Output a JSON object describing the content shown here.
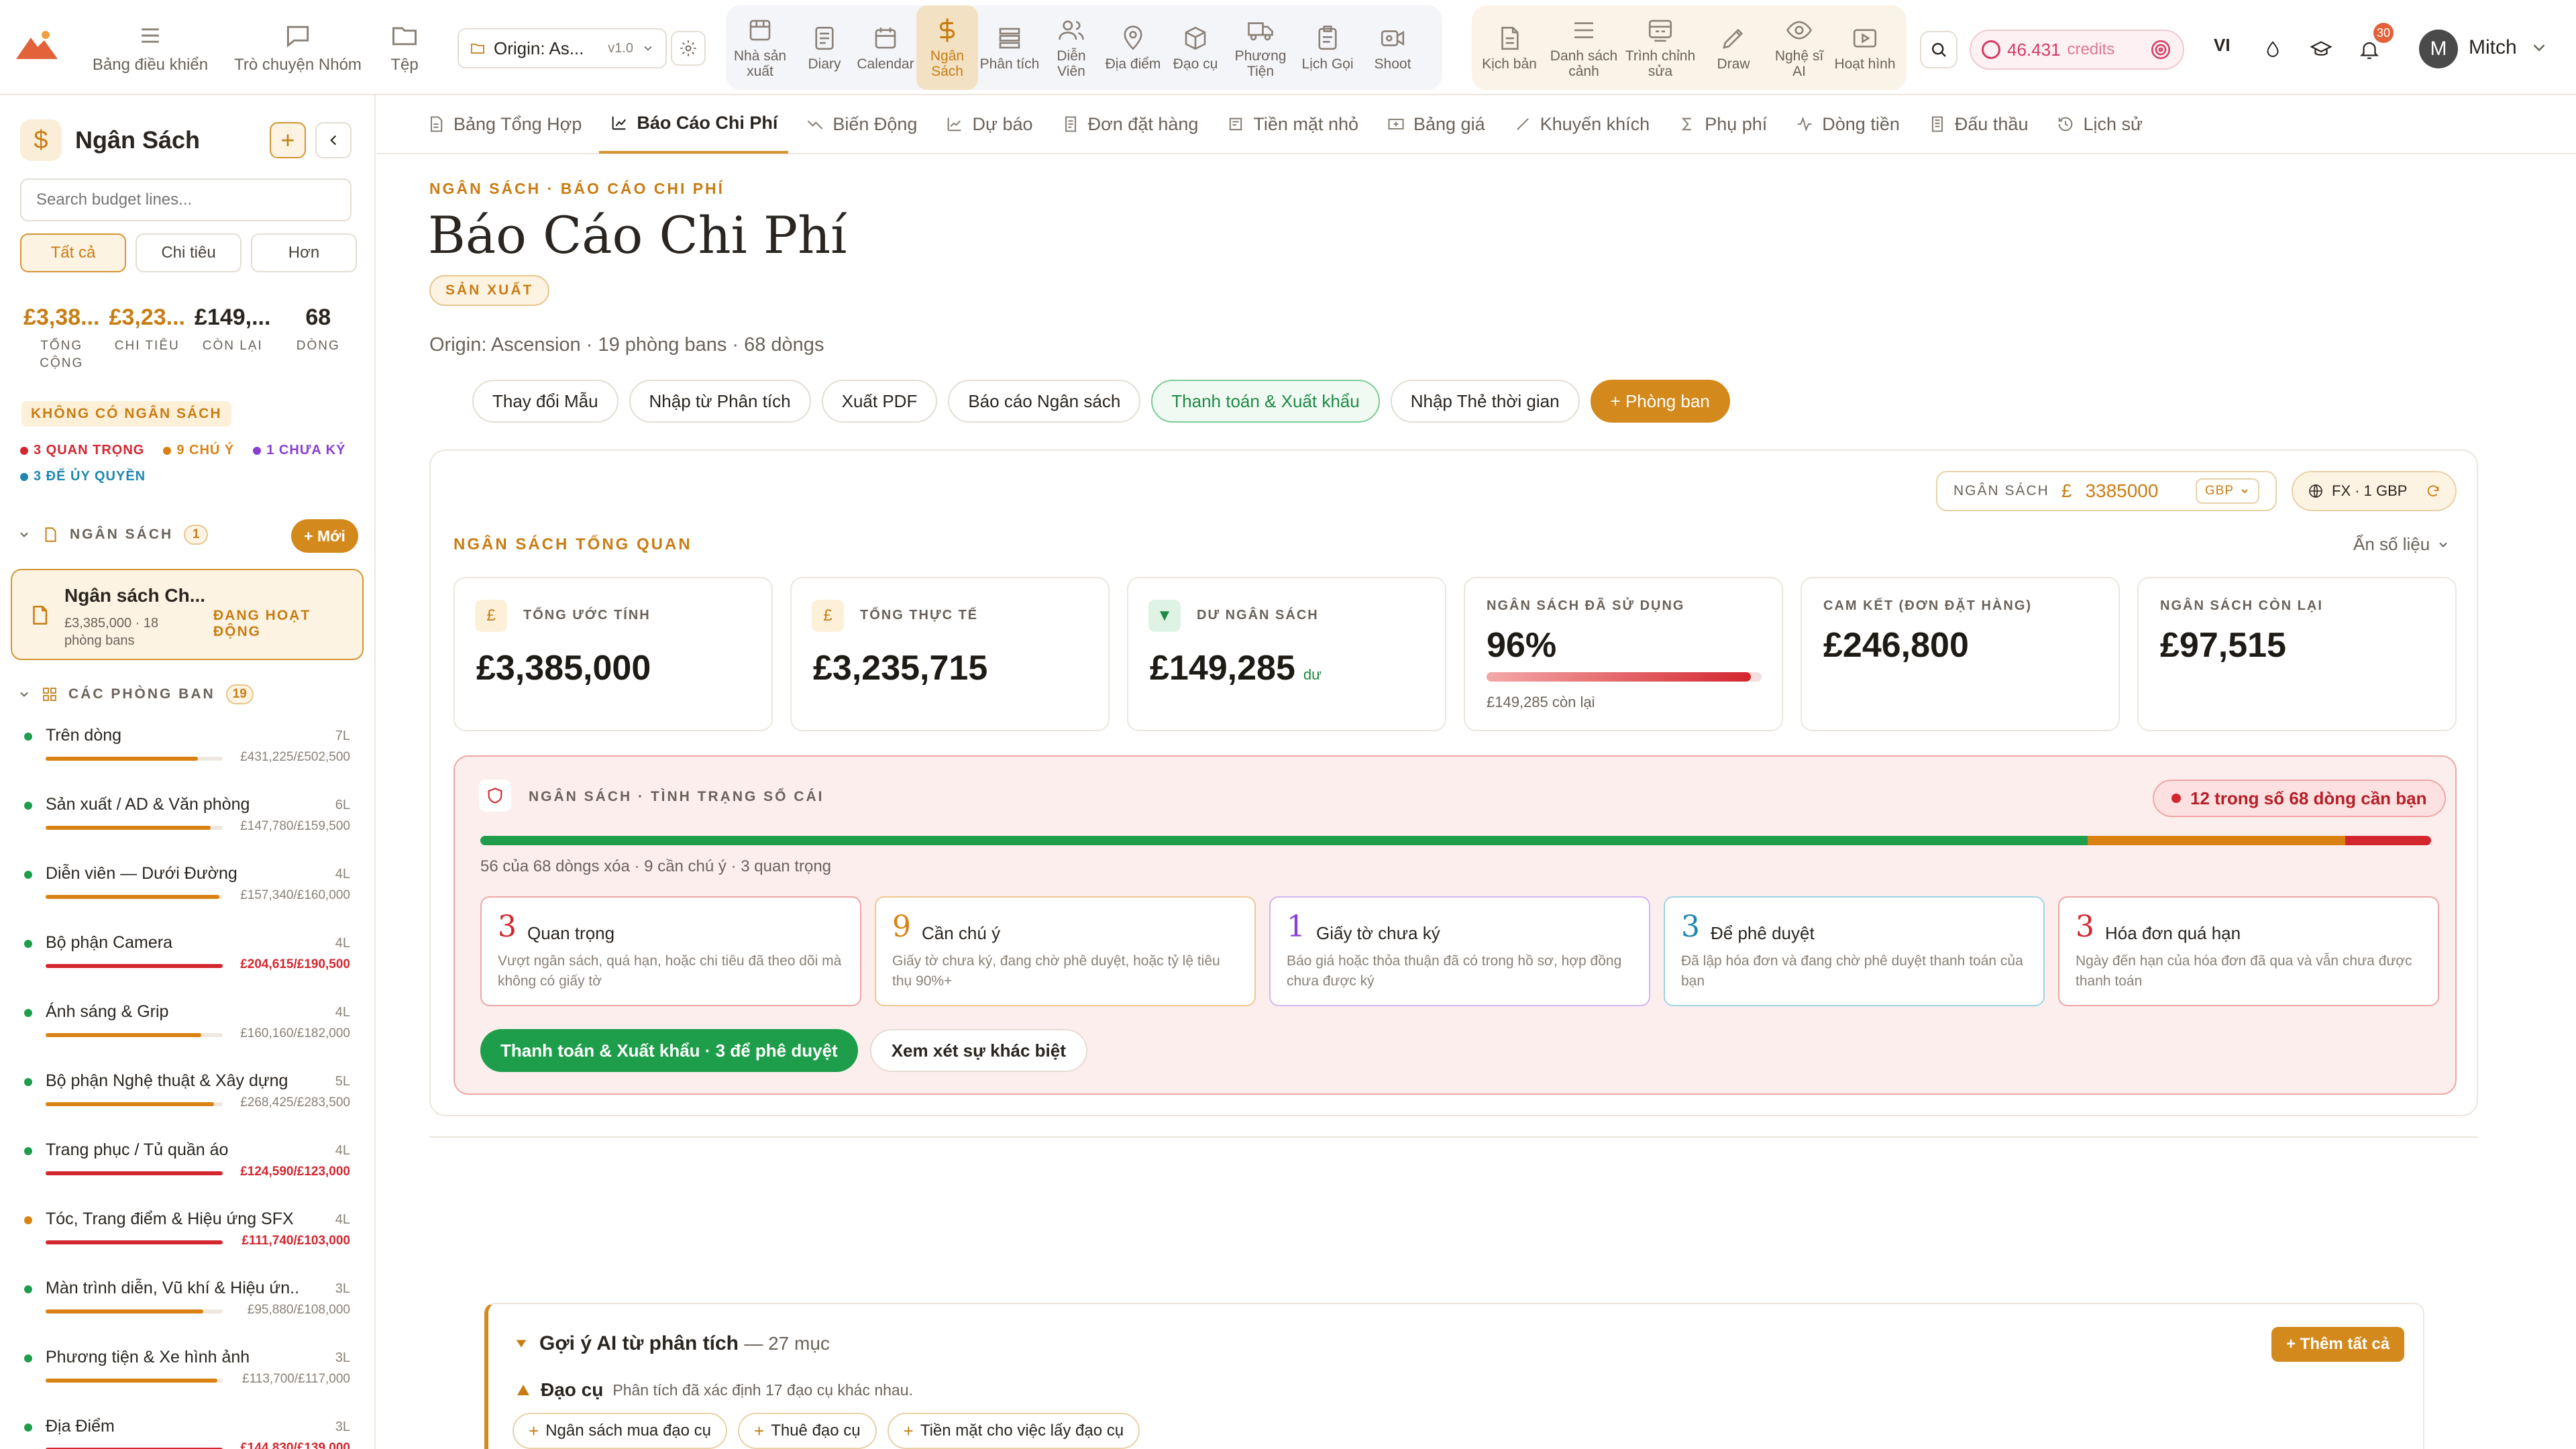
{
  "topnav": {
    "left": [
      {
        "label": "Bảng điều khiển",
        "icon": "menu-icon"
      },
      {
        "label": "Trò chuyện Nhóm",
        "icon": "chat-icon"
      },
      {
        "label": "Tệp",
        "icon": "folder-icon"
      }
    ],
    "origin": {
      "label": "Origin: As...",
      "version": "v1.0"
    },
    "group1": [
      {
        "label": "Nhà sản xuất",
        "icon": "producer-icon"
      },
      {
        "label": "Diary",
        "icon": "diary-icon"
      },
      {
        "label": "Calendar",
        "icon": "calendar-icon"
      },
      {
        "label": "Ngân Sách",
        "icon": "dollar-icon",
        "active": true
      },
      {
        "label": "Phân tích",
        "icon": "analysis-icon"
      },
      {
        "label": "Diễn Viên",
        "icon": "cast-icon"
      },
      {
        "label": "Địa điểm",
        "icon": "location-icon"
      },
      {
        "label": "Đạo cụ",
        "icon": "props-icon"
      },
      {
        "label": "Phương Tiện",
        "icon": "vehicle-icon"
      },
      {
        "label": "Lịch Gọi",
        "icon": "callsheet-icon"
      },
      {
        "label": "Shoot",
        "icon": "camera-icon"
      }
    ],
    "group2": [
      {
        "label": "Kịch bản",
        "icon": "script-icon"
      },
      {
        "label": "Danh sách cảnh",
        "icon": "list-icon"
      },
      {
        "label": "Trình chỉnh sửa",
        "icon": "editor-icon"
      },
      {
        "label": "Draw",
        "icon": "pen-icon"
      },
      {
        "label": "Nghệ sĩ AI",
        "icon": "eye-icon"
      },
      {
        "label": "Hoạt hình",
        "icon": "play-icon"
      }
    ],
    "credits": {
      "amount": "46.431",
      "label": "credits"
    },
    "lang": "VI",
    "notifications": "30",
    "user": {
      "initial": "M",
      "name": "Mitch"
    }
  },
  "sidebar": {
    "title": "Ngân Sách",
    "search_placeholder": "Search budget lines...",
    "filters": [
      "Tất cả",
      "Chi tiêu",
      "Hơn"
    ],
    "stats": [
      {
        "value": "£3,38...",
        "label": "TỔNG CỘNG"
      },
      {
        "value": "£3,23...",
        "label": "CHI TIÊU"
      },
      {
        "value": "£149,...",
        "label": "CÒN LẠI"
      },
      {
        "value": "68",
        "label": "DÒNG"
      }
    ],
    "no_budget": "KHÔNG CÓ NGÂN SÁCH",
    "badges": [
      {
        "text": "3 QUAN TRỌNG",
        "color": "#d3262f"
      },
      {
        "text": "9 CHÚ Ý",
        "color": "#d98213"
      },
      {
        "text": "1 CHƯA KÝ",
        "color": "#8a3fd1"
      },
      {
        "text": "3 ĐỂ ỦY QUYỀN",
        "color": "#1e86b0"
      }
    ],
    "budgets_section": {
      "label": "NGÂN SÁCH",
      "count": "1",
      "new_label": "+ Mới"
    },
    "active_budget": {
      "title": "Ngân sách Ch...",
      "subtitle": "£3,385,000 · 18 phòng bans",
      "status": "ĐANG HOẠT ĐỘNG"
    },
    "depts_section": {
      "label": "CÁC PHÒNG BAN",
      "count": "19"
    },
    "departments": [
      {
        "name": "Trên dòng",
        "lines": "7L",
        "spent": "£431,225",
        "budget": "£502,500",
        "ratio": 0.86,
        "over": false,
        "dot": "#1e9e4a"
      },
      {
        "name": "Sản xuất / AD & Văn phòng",
        "lines": "6L",
        "spent": "£147,780",
        "budget": "£159,500",
        "ratio": 0.93,
        "over": false,
        "dot": "#1e9e4a"
      },
      {
        "name": "Diễn viên — Dưới Đường",
        "lines": "4L",
        "spent": "£157,340",
        "budget": "£160,000",
        "ratio": 0.98,
        "over": false,
        "dot": "#1e9e4a"
      },
      {
        "name": "Bộ phận Camera",
        "lines": "4L",
        "spent": "£204,615",
        "budget": "£190,500",
        "ratio": 1,
        "over": true,
        "dot": "#1e9e4a"
      },
      {
        "name": "Ánh sáng & Grip",
        "lines": "4L",
        "spent": "£160,160",
        "budget": "£182,000",
        "ratio": 0.88,
        "over": false,
        "dot": "#1e9e4a"
      },
      {
        "name": "Bộ phận Nghệ thuật & Xây dựng",
        "lines": "5L",
        "spent": "£268,425",
        "budget": "£283,500",
        "ratio": 0.95,
        "over": false,
        "dot": "#1e9e4a"
      },
      {
        "name": "Trang phục / Tủ quần áo",
        "lines": "4L",
        "spent": "£124,590",
        "budget": "£123,000",
        "ratio": 1,
        "over": true,
        "dot": "#1e9e4a"
      },
      {
        "name": "Tóc, Trang điểm & Hiệu ứng SFX",
        "lines": "4L",
        "spent": "£111,740",
        "budget": "£103,000",
        "ratio": 1,
        "over": true,
        "dot": "#d98213"
      },
      {
        "name": "Màn trình diễn, Vũ khí & Hiệu ứn...",
        "lines": "3L",
        "spent": "£95,880",
        "budget": "£108,000",
        "ratio": 0.89,
        "over": false,
        "dot": "#1e9e4a"
      },
      {
        "name": "Phương tiện & Xe hình ảnh",
        "lines": "3L",
        "spent": "£113,700",
        "budget": "£117,000",
        "ratio": 0.97,
        "over": false,
        "dot": "#1e9e4a"
      },
      {
        "name": "Địa Điểm",
        "lines": "3L",
        "spent": "£144,830",
        "budget": "£139,000",
        "ratio": 1,
        "over": true,
        "dot": "#1e9e4a"
      }
    ]
  },
  "subtabs": [
    {
      "label": "Bảng Tổng Hợp",
      "icon": "doc-icon"
    },
    {
      "label": "Báo Cáo Chi Phí",
      "icon": "chart-icon",
      "active": true
    },
    {
      "label": "Biến Động",
      "icon": "trend-icon"
    },
    {
      "label": "Dự báo",
      "icon": "forecast-icon"
    },
    {
      "label": "Đơn đặt hàng",
      "icon": "order-icon"
    },
    {
      "label": "Tiền mặt nhỏ",
      "icon": "cash-icon"
    },
    {
      "label": "Bảng giá",
      "icon": "price-icon"
    },
    {
      "label": "Khuyến khích",
      "icon": "percent-icon"
    },
    {
      "label": "Phụ phí",
      "icon": "sigma-icon"
    },
    {
      "label": "Dòng tiền",
      "icon": "pulse-icon"
    },
    {
      "label": "Đấu thầu",
      "icon": "tender-icon"
    },
    {
      "label": "Lịch sử",
      "icon": "history-icon"
    }
  ],
  "main": {
    "breadcrumb": "NGÂN SÁCH · BÁO CÁO CHI PHÍ",
    "title": "Báo Cáo Chi Phí",
    "tag": "SẢN XUẤT",
    "subtitle": "Origin: Ascension · 19 phòng bans · 68 dòngs",
    "actions": [
      {
        "label": "Thay đổi Mẫu",
        "style": "plain"
      },
      {
        "label": "Nhập từ Phân tích",
        "style": "plain"
      },
      {
        "label": "Xuất PDF",
        "style": "plain"
      },
      {
        "label": "Báo cáo Ngân sách",
        "style": "plain"
      },
      {
        "label": "Thanh toán & Xuất khẩu",
        "style": "green"
      },
      {
        "label": "Nhập Thẻ thời gian",
        "style": "plain"
      },
      {
        "label": "+ Phòng ban",
        "style": "gold"
      }
    ],
    "budget_input": {
      "label": "NGÂN SÁCH",
      "symbol": "£",
      "value": "3385000",
      "currency": "GBP"
    },
    "fx": "FX · 1 GBP",
    "overview_label": "NGÂN SÁCH TỔNG QUAN",
    "hide_figures": "Ẩn số liệu",
    "metrics": [
      {
        "label": "TỔNG ƯỚC TÍNH",
        "value": "£3,385,000",
        "icon": "£"
      },
      {
        "label": "TỔNG THỰC TẾ",
        "value": "£3,235,715",
        "icon": "£"
      },
      {
        "label": "DƯ NGÂN SÁCH",
        "value": "£149,285",
        "unit": "dư",
        "icon": "▼"
      },
      {
        "label": "NGÂN SÁCH ĐÃ SỬ DỤNG",
        "value": "96%",
        "used_ratio": 0.96,
        "sub": "£149,285 còn lại"
      },
      {
        "label": "CAM KẾT (ĐƠN ĐẶT HÀNG)",
        "value": "£246,800"
      },
      {
        "label": "NGÂN SÁCH CÒN LẠI",
        "value": "£97,515"
      }
    ],
    "ledger": {
      "title": "NGÂN SÁCH · TÌNH TRẠNG SỔ CÁI",
      "flag": "12 trong số 68 dòng cần bạn",
      "progress": [
        {
          "ratio": 0.824,
          "color": "#1e9e4a"
        },
        {
          "ratio": 0.132,
          "color": "#d98213"
        },
        {
          "ratio": 0.044,
          "color": "#d3262f"
        }
      ],
      "summary": "56 của 68 dòngs xóa · 9 cần chú ý · 3 quan trọng",
      "cards": [
        {
          "num": "3",
          "title": "Quan trọng",
          "desc": "Vượt ngân sách, quá hạn, hoặc chi tiêu đã theo dõi mà không có giấy tờ",
          "color": "#d3262f",
          "border": "#f0a6a6"
        },
        {
          "num": "9",
          "title": "Cần chú ý",
          "desc": "Giấy tờ chưa ký, đang chờ phê duyệt, hoặc tỷ lệ tiêu thụ 90%+",
          "color": "#d98213",
          "border": "#f3c790"
        },
        {
          "num": "1",
          "title": "Giấy tờ chưa ký",
          "desc": "Báo giá hoặc thỏa thuận đã có trong hồ sơ, hợp đồng chưa được ký",
          "color": "#8a3fd1",
          "border": "#d3b5f0"
        },
        {
          "num": "3",
          "title": "Để phê duyệt",
          "desc": "Đã lập hóa đơn và đang chờ phê duyệt thanh toán của bạn",
          "color": "#1e86b0",
          "border": "#9fd3e6"
        },
        {
          "num": "3",
          "title": "Hóa đơn quá hạn",
          "desc": "Ngày đến hạn của hóa đơn đã qua và vẫn chưa được thanh toán",
          "color": "#d3262f",
          "border": "#f0a6a6"
        }
      ],
      "pay_button": "Thanh toán & Xuất khẩu · 3 để phê duyệt",
      "review_button": "Xem xét sự khác biệt"
    },
    "ai": {
      "title": "Gợi ý AI từ phân tích",
      "count": "— 27 mục",
      "add_all": "+ Thêm tất cả",
      "section": "Đạo cụ",
      "section_desc": "Phân tích đã xác định 17 đạo cụ khác nhau.",
      "chips": [
        "Ngân sách mua đạo cụ",
        "Thuê đạo cụ",
        "Tiền mặt cho việc lấy đạo cụ"
      ]
    }
  },
  "colors": {
    "accent": "#d4891c",
    "green": "#1e9e4a",
    "red": "#d3262f",
    "orange": "#d98213"
  }
}
